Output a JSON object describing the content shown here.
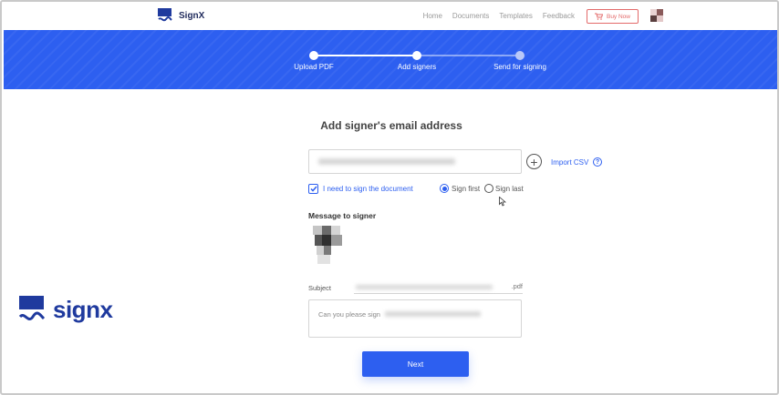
{
  "header": {
    "app_name": "SignX",
    "nav": [
      "Home",
      "Documents",
      "Templates",
      "Feedback"
    ],
    "buy_label": "Buy Now"
  },
  "steps": [
    {
      "label": "Upload PDF",
      "status": "done"
    },
    {
      "label": "Add signers",
      "status": "current"
    },
    {
      "label": "Send for signing",
      "status": "pending"
    }
  ],
  "form": {
    "title": "Add signer's email address",
    "import_label": "Import CSV",
    "help_symbol": "?",
    "checkbox_label": "I need to sign the document",
    "checkbox_checked": true,
    "radio_first": "Sign first",
    "radio_last": "Sign last",
    "radio_selected": "Sign first",
    "message_heading": "Message to signer",
    "subject_label": "Subject",
    "subject_suffix": ".pdf",
    "message_text": "Can you please sign",
    "next_label": "Next"
  },
  "brand": {
    "name": "signx"
  },
  "colors": {
    "accent": "#2d5ff0",
    "brand_dark": "#1f3a9e",
    "buy_red": "#e36a6a"
  }
}
